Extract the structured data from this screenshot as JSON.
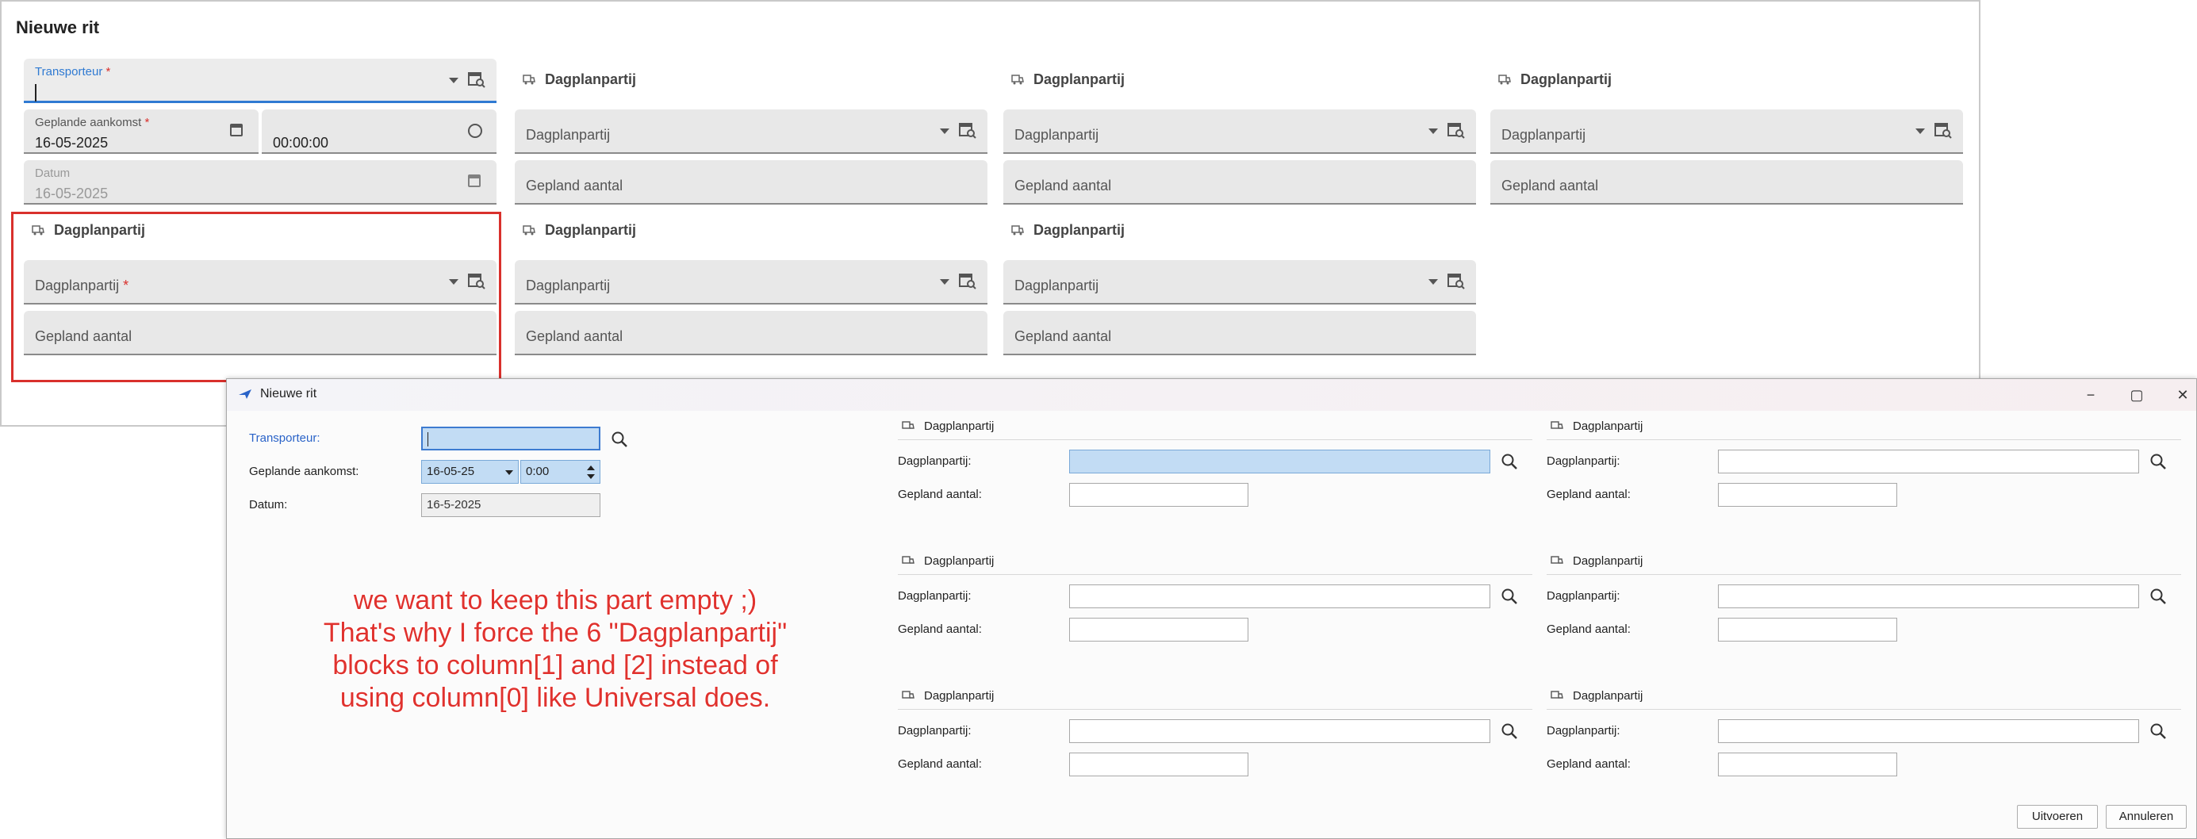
{
  "web": {
    "title": "Nieuwe rit",
    "transporteur_label": "Transporteur",
    "required_mark": "*",
    "aankomst_label": "Geplande aankomst",
    "aankomst_date": "16-05-2025",
    "aankomst_time": "00:00:00",
    "datum_label": "Datum",
    "datum_value": "16-05-2025",
    "section_title": "Dagplanpartij",
    "dagplan_placeholder": "Dagplanpartij",
    "aantal_placeholder": "Gepland aantal"
  },
  "native": {
    "title": "Nieuwe rit",
    "transporteur_label": "Transporteur:",
    "aankomst_label": "Geplande aankomst:",
    "aankomst_date": "16-05-25",
    "aankomst_time": "0:00",
    "datum_label": "Datum:",
    "datum_value": "16-5-2025",
    "section_title": "Dagplanpartij",
    "dagplan_label": "Dagplanpartij:",
    "aantal_label": "Gepland aantal:",
    "ok_button": "Uitvoeren",
    "cancel_button": "Annuleren",
    "window_minimize": "−",
    "window_maximize": "▢",
    "window_close": "✕"
  },
  "annotation": {
    "lines": [
      "we want to keep this part empty ;)",
      "That's why I force the 6 \"Dagplanpartij\"",
      "blocks to column[1] and [2] instead of",
      "using column[0] like Universal does."
    ]
  },
  "colors": {
    "accent": "#2f7ad2",
    "annotation": "#e0322e",
    "selection": "#c2dcf4"
  }
}
